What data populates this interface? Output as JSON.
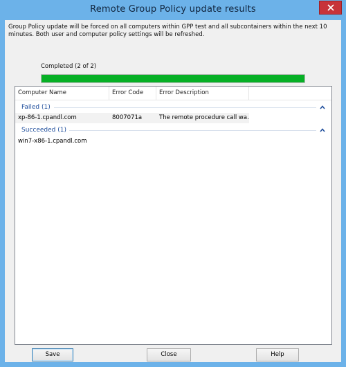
{
  "window": {
    "title": "Remote Group Policy update results"
  },
  "description": "Group Policy update will be forced on all computers within GPP test and all subcontainers within the next 10 minutes. Both user and computer policy settings will be refreshed.",
  "progress": {
    "label": "Completed (2 of 2)",
    "fraction": 1.0,
    "color": "#06b025"
  },
  "columns": [
    "Computer Name",
    "Error Code",
    "Error Description"
  ],
  "groups": {
    "failed": {
      "title": "Failed (1)",
      "rows": [
        {
          "computer": "xp-86-1.cpandl.com",
          "code": "8007071a",
          "description": "The remote procedure call wa..."
        }
      ]
    },
    "succeeded": {
      "title": "Succeeded (1)",
      "rows": [
        {
          "computer": "win7-x86-1.cpandl.com",
          "code": "",
          "description": ""
        }
      ]
    }
  },
  "buttons": {
    "save": "Save",
    "close": "Close",
    "help": "Help"
  },
  "icons": {
    "close": "close-icon",
    "collapse": "chevron-up-icon"
  },
  "colors": {
    "titlebar": "#6cb2e9",
    "group_header": "#1f4e9c",
    "close_button": "#c7333a"
  }
}
